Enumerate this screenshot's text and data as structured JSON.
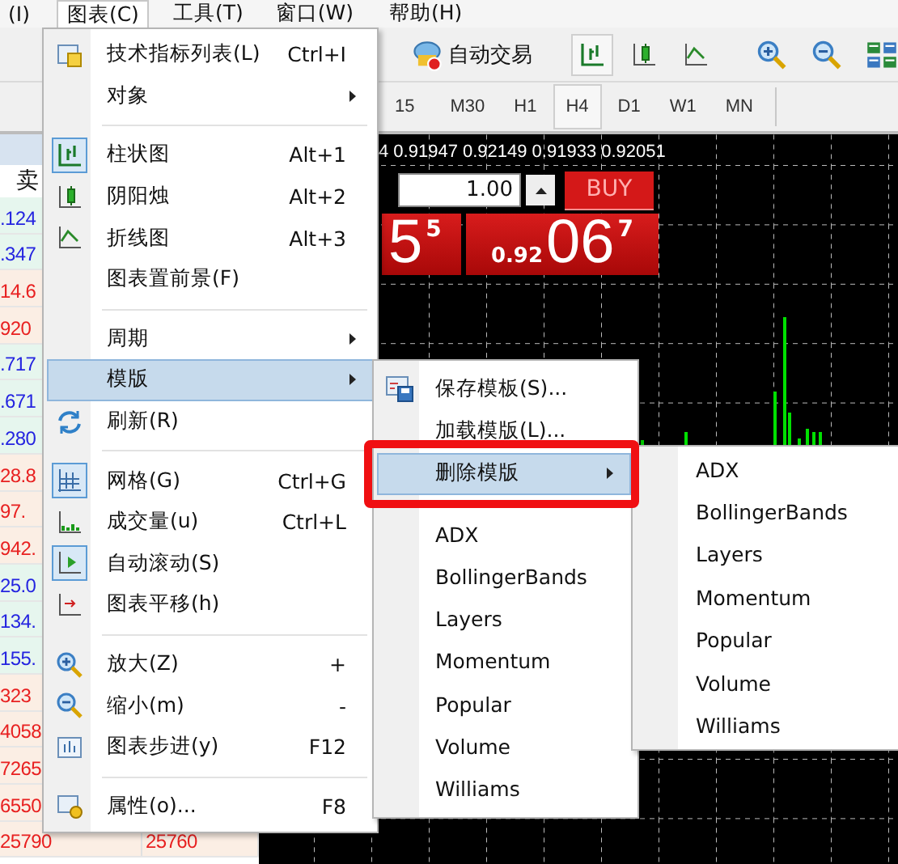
{
  "menubar": [
    {
      "label": "(I)",
      "selected": false
    },
    {
      "label": "图表(C)",
      "selected": true
    },
    {
      "label": "工具(T)",
      "selected": false
    },
    {
      "label": "窗口(W)",
      "selected": false
    },
    {
      "label": "帮助(H)",
      "selected": false
    }
  ],
  "toolbar": {
    "autotrade": "自动交易"
  },
  "timeframes": [
    {
      "label": "15",
      "selected": false
    },
    {
      "label": "M30",
      "selected": false
    },
    {
      "label": "H1",
      "selected": false
    },
    {
      "label": "H4",
      "selected": true
    },
    {
      "label": "D1",
      "selected": false
    },
    {
      "label": "W1",
      "selected": false
    },
    {
      "label": "MN",
      "selected": false
    }
  ],
  "market_watch": {
    "header": "卖",
    "rows": [
      {
        "bid": ".124",
        "color": "#2424e0"
      },
      {
        "bid": ".347",
        "color": "#2424e0"
      },
      {
        "bid": "14.6",
        "color": "#e82020"
      },
      {
        "bid": "920",
        "color": "#e82020"
      },
      {
        "bid": ".717",
        "color": "#2424e0"
      },
      {
        "bid": ".671",
        "color": "#2424e0"
      },
      {
        "bid": ".280",
        "color": "#2424e0"
      },
      {
        "bid": "28.8",
        "color": "#e82020"
      },
      {
        "bid": "97.",
        "color": "#e82020"
      },
      {
        "bid": "942.",
        "color": "#e82020"
      },
      {
        "bid": "25.0",
        "color": "#2424e0"
      },
      {
        "bid": "134.",
        "color": "#2424e0"
      },
      {
        "bid": "155.",
        "color": "#2424e0"
      },
      {
        "bid": "323",
        "color": "#e82020"
      },
      {
        "bid": "4058",
        "color": "#e82020"
      },
      {
        "bid": "7265",
        "color": "#e82020"
      },
      {
        "bid": "6550",
        "color": "#e82020"
      },
      {
        "bid": "25790",
        "ask": "25760",
        "color": "#e82020"
      }
    ]
  },
  "chart": {
    "ohlc": "4 0.91947 0.92149 0.91933 0.92051",
    "lot": "1.00",
    "buy_label": "BUY",
    "sell_price": {
      "big": "5",
      "sup": "5"
    },
    "buy_price": {
      "small": "0.92",
      "big": "06",
      "sup": "7"
    }
  },
  "chart_menu": {
    "items": [
      {
        "kind": "item",
        "label": "技术指标列表(L)",
        "shortcut": "Ctrl+I",
        "checked": false,
        "selected": false
      },
      {
        "kind": "item",
        "label": "对象",
        "submenu": true,
        "selected": false
      },
      {
        "kind": "separator"
      },
      {
        "kind": "item",
        "label": "柱状图",
        "shortcut": "Alt+1",
        "checked": true,
        "selected": false
      },
      {
        "kind": "item",
        "label": "阴阳烛",
        "shortcut": "Alt+2",
        "checked": false,
        "selected": false
      },
      {
        "kind": "item",
        "label": "折线图",
        "shortcut": "Alt+3",
        "checked": false,
        "selected": false
      },
      {
        "kind": "item",
        "label": "图表置前景(F)",
        "selected": false
      },
      {
        "kind": "separator"
      },
      {
        "kind": "item",
        "label": "周期",
        "submenu": true,
        "selected": false
      },
      {
        "kind": "item",
        "label": "模版",
        "submenu": true,
        "selected": true
      },
      {
        "kind": "item",
        "label": "刷新(R)",
        "checked": false,
        "selected": false
      },
      {
        "kind": "separator"
      },
      {
        "kind": "item",
        "label": "网格(G)",
        "shortcut": "Ctrl+G",
        "checked": true,
        "selected": false
      },
      {
        "kind": "item",
        "label": "成交量(u)",
        "shortcut": "Ctrl+L",
        "checked": false,
        "selected": false
      },
      {
        "kind": "item",
        "label": "自动滚动(S)",
        "checked": true,
        "selected": false
      },
      {
        "kind": "item",
        "label": "图表平移(h)",
        "checked": false,
        "selected": false
      },
      {
        "kind": "separator"
      },
      {
        "kind": "item",
        "label": "放大(Z)",
        "shortcut": "+",
        "checked": false,
        "selected": false
      },
      {
        "kind": "item",
        "label": "缩小(m)",
        "shortcut": "-",
        "checked": false,
        "selected": false
      },
      {
        "kind": "item",
        "label": "图表步进(y)",
        "shortcut": "F12",
        "checked": false,
        "selected": false
      },
      {
        "kind": "separator"
      },
      {
        "kind": "item",
        "label": "属性(o)...",
        "shortcut": "F8",
        "checked": false,
        "selected": false
      }
    ]
  },
  "template_menu": {
    "items": [
      {
        "kind": "item",
        "label": "保存模板(S)...",
        "selected": false
      },
      {
        "kind": "item",
        "label": "加载模版(L)...",
        "selected": false
      },
      {
        "kind": "item",
        "label": "删除模版",
        "submenu": true,
        "selected": true,
        "outlined": true
      },
      {
        "kind": "separator"
      },
      {
        "kind": "item",
        "label": "ADX",
        "selected": false
      },
      {
        "kind": "item",
        "label": "BollingerBands",
        "selected": false
      },
      {
        "kind": "item",
        "label": "Layers",
        "selected": false
      },
      {
        "kind": "item",
        "label": "Momentum",
        "selected": false
      },
      {
        "kind": "item",
        "label": "Popular",
        "selected": false
      },
      {
        "kind": "item",
        "label": "Volume",
        "selected": false
      },
      {
        "kind": "item",
        "label": "Williams",
        "selected": false
      }
    ]
  },
  "delete_menu": {
    "items": [
      {
        "kind": "item",
        "label": "ADX",
        "selected": false
      },
      {
        "kind": "item",
        "label": "BollingerBands",
        "selected": false
      },
      {
        "kind": "item",
        "label": "Layers",
        "selected": false
      },
      {
        "kind": "item",
        "label": "Momentum",
        "selected": false
      },
      {
        "kind": "item",
        "label": "Popular",
        "selected": false
      },
      {
        "kind": "item",
        "label": "Volume",
        "selected": false
      },
      {
        "kind": "item",
        "label": "Williams",
        "selected": false
      }
    ]
  }
}
